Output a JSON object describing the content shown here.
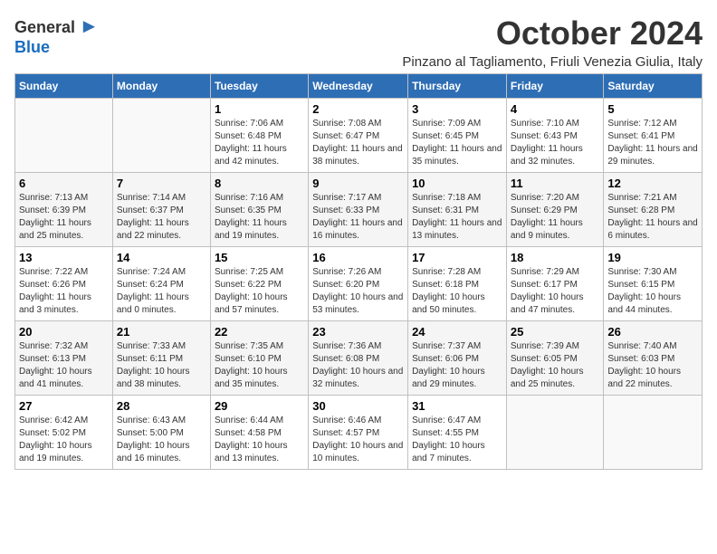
{
  "logo": {
    "general": "General",
    "blue": "Blue"
  },
  "title": "October 2024",
  "subtitle": "Pinzano al Tagliamento, Friuli Venezia Giulia, Italy",
  "days_of_week": [
    "Sunday",
    "Monday",
    "Tuesday",
    "Wednesday",
    "Thursday",
    "Friday",
    "Saturday"
  ],
  "weeks": [
    [
      {
        "day": "",
        "info": ""
      },
      {
        "day": "",
        "info": ""
      },
      {
        "day": "1",
        "info": "Sunrise: 7:06 AM\nSunset: 6:48 PM\nDaylight: 11 hours and 42 minutes."
      },
      {
        "day": "2",
        "info": "Sunrise: 7:08 AM\nSunset: 6:47 PM\nDaylight: 11 hours and 38 minutes."
      },
      {
        "day": "3",
        "info": "Sunrise: 7:09 AM\nSunset: 6:45 PM\nDaylight: 11 hours and 35 minutes."
      },
      {
        "day": "4",
        "info": "Sunrise: 7:10 AM\nSunset: 6:43 PM\nDaylight: 11 hours and 32 minutes."
      },
      {
        "day": "5",
        "info": "Sunrise: 7:12 AM\nSunset: 6:41 PM\nDaylight: 11 hours and 29 minutes."
      }
    ],
    [
      {
        "day": "6",
        "info": "Sunrise: 7:13 AM\nSunset: 6:39 PM\nDaylight: 11 hours and 25 minutes."
      },
      {
        "day": "7",
        "info": "Sunrise: 7:14 AM\nSunset: 6:37 PM\nDaylight: 11 hours and 22 minutes."
      },
      {
        "day": "8",
        "info": "Sunrise: 7:16 AM\nSunset: 6:35 PM\nDaylight: 11 hours and 19 minutes."
      },
      {
        "day": "9",
        "info": "Sunrise: 7:17 AM\nSunset: 6:33 PM\nDaylight: 11 hours and 16 minutes."
      },
      {
        "day": "10",
        "info": "Sunrise: 7:18 AM\nSunset: 6:31 PM\nDaylight: 11 hours and 13 minutes."
      },
      {
        "day": "11",
        "info": "Sunrise: 7:20 AM\nSunset: 6:29 PM\nDaylight: 11 hours and 9 minutes."
      },
      {
        "day": "12",
        "info": "Sunrise: 7:21 AM\nSunset: 6:28 PM\nDaylight: 11 hours and 6 minutes."
      }
    ],
    [
      {
        "day": "13",
        "info": "Sunrise: 7:22 AM\nSunset: 6:26 PM\nDaylight: 11 hours and 3 minutes."
      },
      {
        "day": "14",
        "info": "Sunrise: 7:24 AM\nSunset: 6:24 PM\nDaylight: 11 hours and 0 minutes."
      },
      {
        "day": "15",
        "info": "Sunrise: 7:25 AM\nSunset: 6:22 PM\nDaylight: 10 hours and 57 minutes."
      },
      {
        "day": "16",
        "info": "Sunrise: 7:26 AM\nSunset: 6:20 PM\nDaylight: 10 hours and 53 minutes."
      },
      {
        "day": "17",
        "info": "Sunrise: 7:28 AM\nSunset: 6:18 PM\nDaylight: 10 hours and 50 minutes."
      },
      {
        "day": "18",
        "info": "Sunrise: 7:29 AM\nSunset: 6:17 PM\nDaylight: 10 hours and 47 minutes."
      },
      {
        "day": "19",
        "info": "Sunrise: 7:30 AM\nSunset: 6:15 PM\nDaylight: 10 hours and 44 minutes."
      }
    ],
    [
      {
        "day": "20",
        "info": "Sunrise: 7:32 AM\nSunset: 6:13 PM\nDaylight: 10 hours and 41 minutes."
      },
      {
        "day": "21",
        "info": "Sunrise: 7:33 AM\nSunset: 6:11 PM\nDaylight: 10 hours and 38 minutes."
      },
      {
        "day": "22",
        "info": "Sunrise: 7:35 AM\nSunset: 6:10 PM\nDaylight: 10 hours and 35 minutes."
      },
      {
        "day": "23",
        "info": "Sunrise: 7:36 AM\nSunset: 6:08 PM\nDaylight: 10 hours and 32 minutes."
      },
      {
        "day": "24",
        "info": "Sunrise: 7:37 AM\nSunset: 6:06 PM\nDaylight: 10 hours and 29 minutes."
      },
      {
        "day": "25",
        "info": "Sunrise: 7:39 AM\nSunset: 6:05 PM\nDaylight: 10 hours and 25 minutes."
      },
      {
        "day": "26",
        "info": "Sunrise: 7:40 AM\nSunset: 6:03 PM\nDaylight: 10 hours and 22 minutes."
      }
    ],
    [
      {
        "day": "27",
        "info": "Sunrise: 6:42 AM\nSunset: 5:02 PM\nDaylight: 10 hours and 19 minutes."
      },
      {
        "day": "28",
        "info": "Sunrise: 6:43 AM\nSunset: 5:00 PM\nDaylight: 10 hours and 16 minutes."
      },
      {
        "day": "29",
        "info": "Sunrise: 6:44 AM\nSunset: 4:58 PM\nDaylight: 10 hours and 13 minutes."
      },
      {
        "day": "30",
        "info": "Sunrise: 6:46 AM\nSunset: 4:57 PM\nDaylight: 10 hours and 10 minutes."
      },
      {
        "day": "31",
        "info": "Sunrise: 6:47 AM\nSunset: 4:55 PM\nDaylight: 10 hours and 7 minutes."
      },
      {
        "day": "",
        "info": ""
      },
      {
        "day": "",
        "info": ""
      }
    ]
  ]
}
